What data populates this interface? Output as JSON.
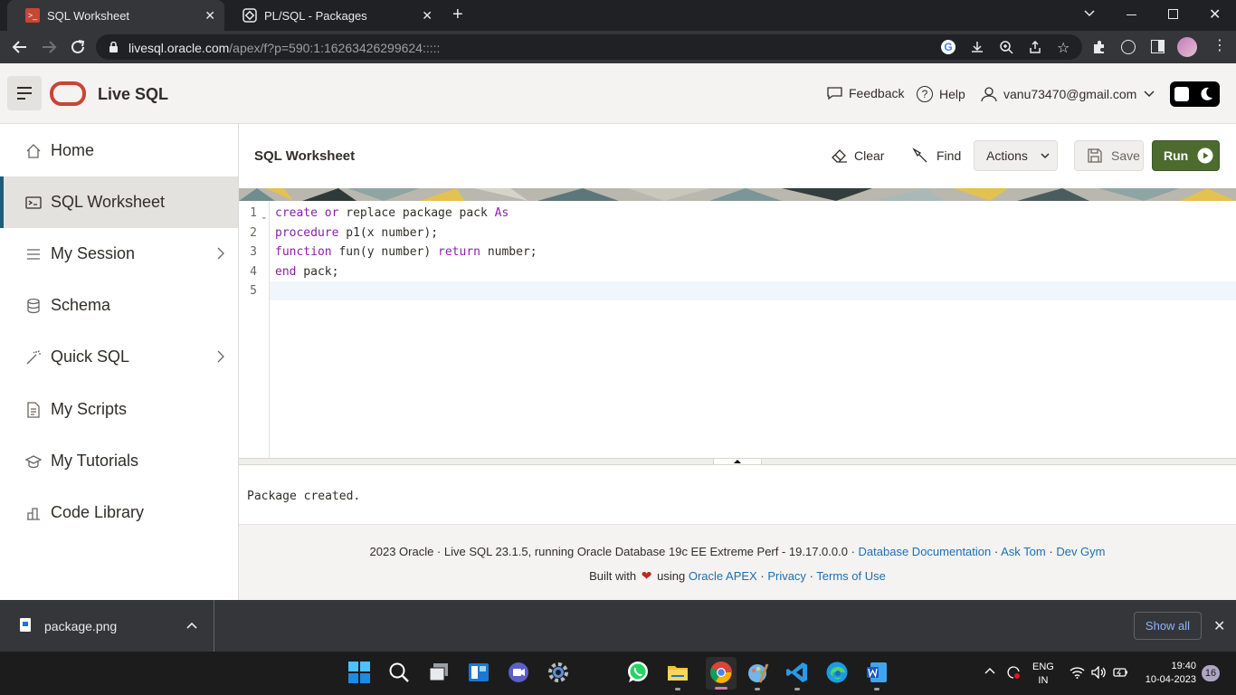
{
  "browser": {
    "tabs": [
      {
        "title": "SQL Worksheet",
        "active": true
      },
      {
        "title": "PL/SQL - Packages",
        "active": false
      }
    ],
    "url_host": "livesql.oracle.com",
    "url_path": "/apex/f?p=590:1:16263426299624:::::"
  },
  "app": {
    "title": "Live SQL",
    "feedback": "Feedback",
    "help": "Help",
    "user": "vanu73470@gmail.com"
  },
  "sidebar": {
    "items": [
      {
        "label": "Home"
      },
      {
        "label": "SQL Worksheet"
      },
      {
        "label": "My Session"
      },
      {
        "label": "Schema"
      },
      {
        "label": "Quick SQL"
      },
      {
        "label": "My Scripts"
      },
      {
        "label": "My Tutorials"
      },
      {
        "label": "Code Library"
      }
    ]
  },
  "worksheet": {
    "title": "SQL Worksheet",
    "clear": "Clear",
    "find": "Find",
    "actions": "Actions",
    "save": "Save",
    "run": "Run"
  },
  "editor": {
    "line_numbers": [
      "1",
      "2",
      "3",
      "4",
      "5"
    ]
  },
  "output": {
    "text": "Package created."
  },
  "footer": {
    "line1": "2023 Oracle · Live SQL 23.1.5, running Oracle Database 19c EE Extreme Perf - 19.17.0.0.0 ·",
    "doc_link": "Database Documentation",
    "sep1": "·",
    "asktom": "Ask Tom",
    "sep2": "·",
    "devgym": "Dev Gym",
    "built_with": "Built with",
    "using": "using",
    "apex": "Oracle APEX",
    "sep3": "·",
    "privacy": "Privacy",
    "sep4": "·",
    "terms": "Terms of Use"
  },
  "download": {
    "filename": "package.png",
    "show_all": "Show all"
  },
  "taskbar": {
    "lang1": "ENG",
    "lang2": "IN",
    "time": "19:40",
    "date": "10-04-2023",
    "notifications": "16"
  },
  "colors": {
    "run_button": "#4d6b2e",
    "active_border": "#1e5c7a",
    "keyword": "#8a1fa8",
    "oracle_red": "#c74634"
  }
}
